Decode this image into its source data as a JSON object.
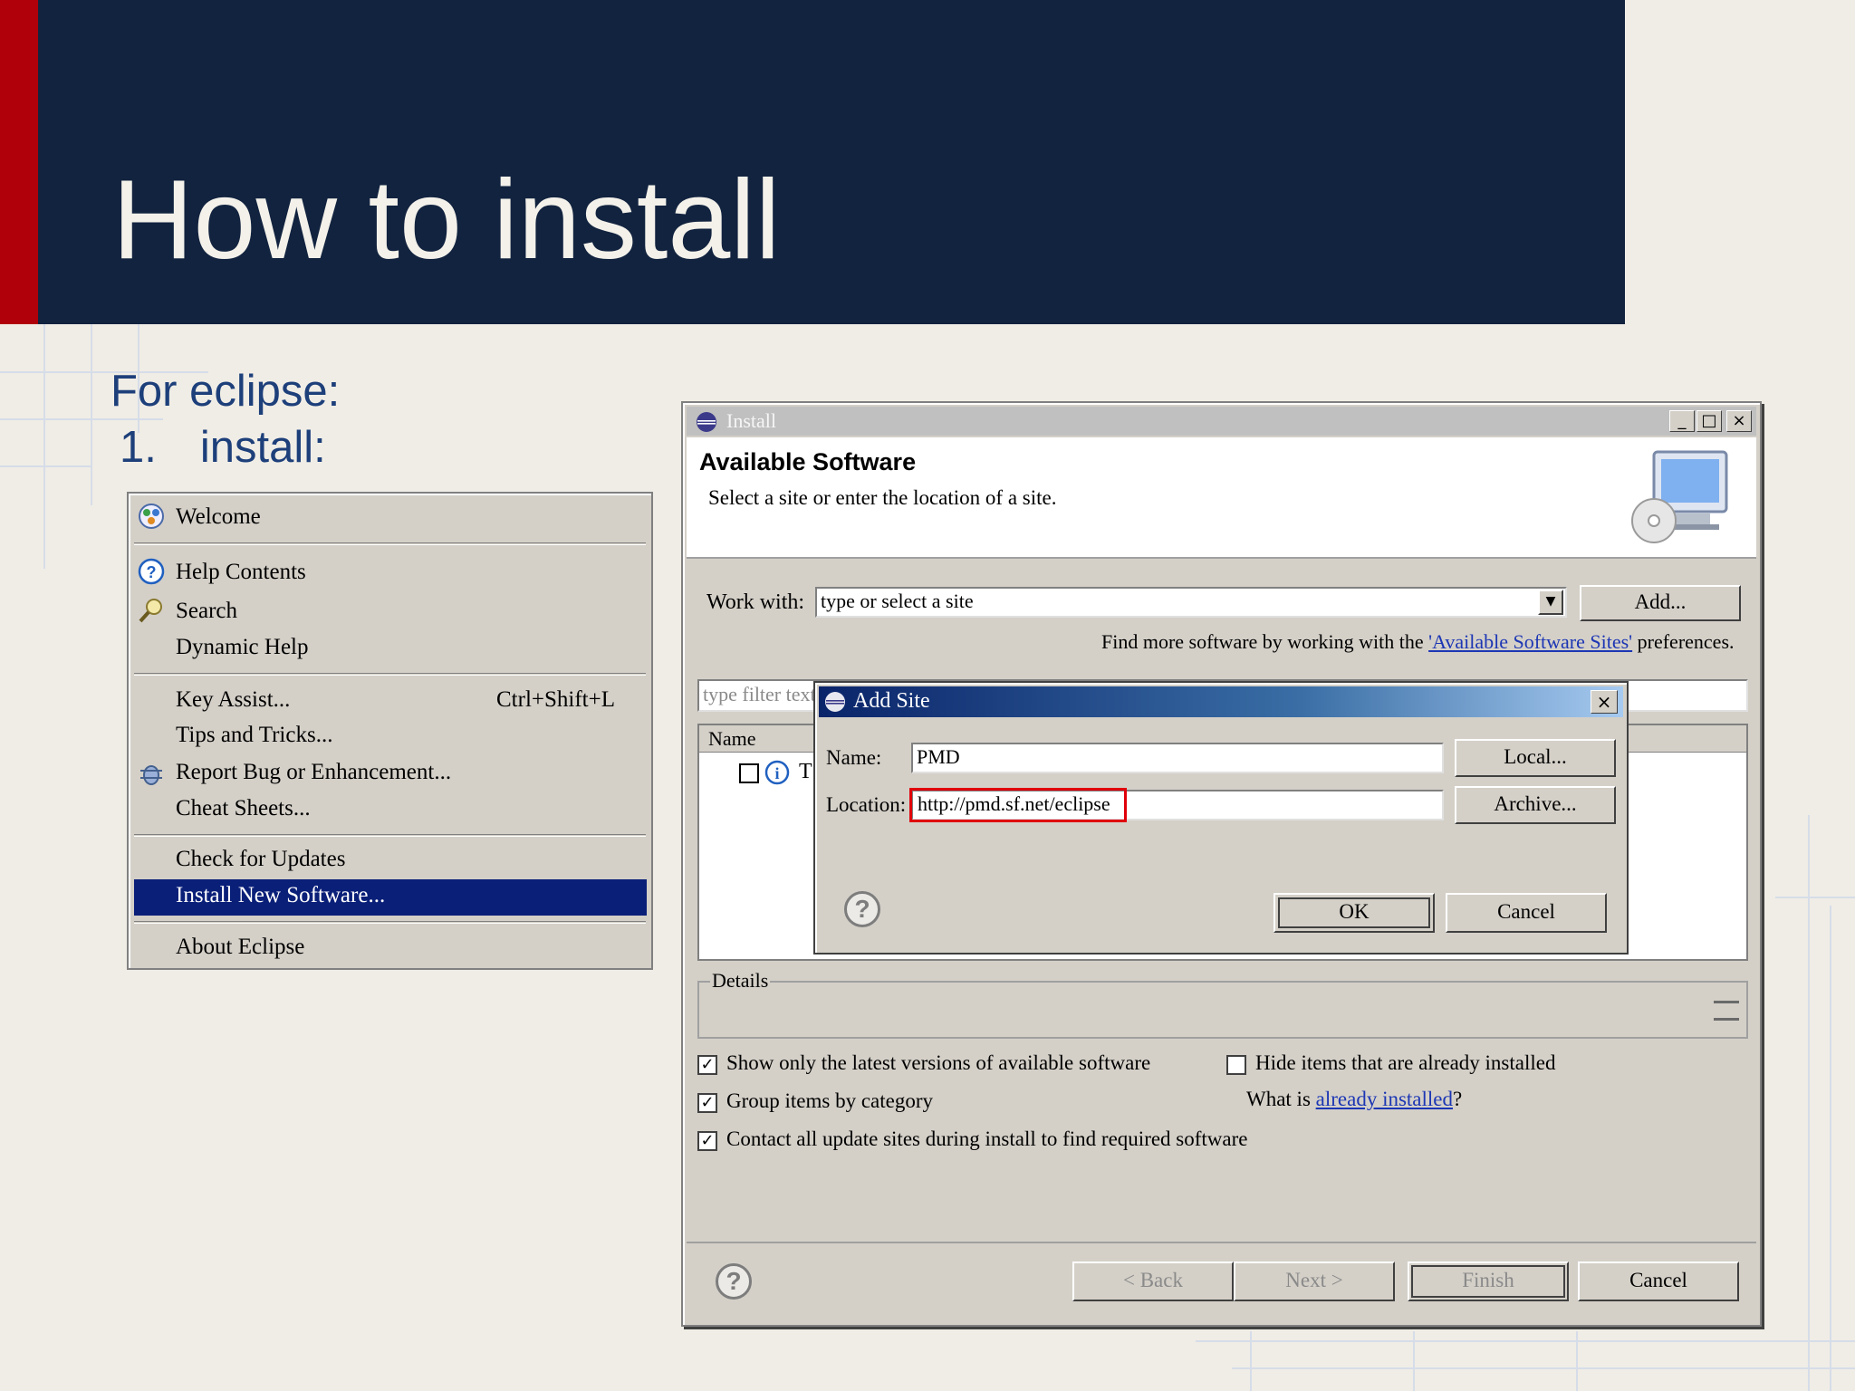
{
  "slide": {
    "title": "How to install",
    "subtitle": "For eclipse:",
    "step_number": "1.",
    "step_text": "install:"
  },
  "help_menu": {
    "items": [
      {
        "label": "Welcome",
        "icon": "welcome-icon"
      },
      {
        "label": "Help Contents",
        "icon": "help-icon"
      },
      {
        "label": "Search",
        "icon": "search-icon"
      },
      {
        "label": "Dynamic Help"
      },
      {
        "label": "Key Assist...",
        "shortcut": "Ctrl+Shift+L"
      },
      {
        "label": "Tips and Tricks..."
      },
      {
        "label": "Report Bug or Enhancement...",
        "icon": "bug-report-icon"
      },
      {
        "label": "Cheat Sheets..."
      },
      {
        "label": "Check for Updates"
      },
      {
        "label": "Install New Software...",
        "selected": true
      },
      {
        "label": "About Eclipse"
      }
    ]
  },
  "install_dialog": {
    "window_title": "Install",
    "header_title": "Available Software",
    "header_desc": "Select a site or enter the location of a site.",
    "work_with_label": "Work with:",
    "work_with_value": "type or select a site",
    "add_button": "Add...",
    "find_more_prefix": "Find more software by working with the ",
    "find_more_link": "'Available Software Sites'",
    "find_more_suffix": " preferences.",
    "filter_placeholder": "type filter text",
    "name_column": "Name",
    "tree_item_text": "T",
    "details_label": "Details",
    "options": [
      {
        "label": "Show only the latest versions of available software",
        "checked": true
      },
      {
        "label": "Group items by category",
        "checked": true
      },
      {
        "label": "Contact all update sites during install to find required software",
        "checked": true
      },
      {
        "label": "Hide items that are already installed",
        "checked": false
      }
    ],
    "what_is_prefix": "What is ",
    "what_is_link": "already installed",
    "what_is_suffix": "?",
    "buttons": {
      "back": "< Back",
      "next": "Next >",
      "finish": "Finish",
      "cancel": "Cancel"
    }
  },
  "add_site_dialog": {
    "title": "Add Site",
    "name_label": "Name:",
    "name_value": "PMD",
    "location_label": "Location:",
    "location_value": "http://pmd.sf.net/eclipse",
    "local_button": "Local...",
    "archive_button": "Archive...",
    "ok_button": "OK",
    "cancel_button": "Cancel"
  },
  "colors": {
    "title_bg": "#12233f",
    "accent_red": "#b0000a",
    "menu_highlight": "#0a1f78",
    "location_highlight": "#e0000a"
  }
}
